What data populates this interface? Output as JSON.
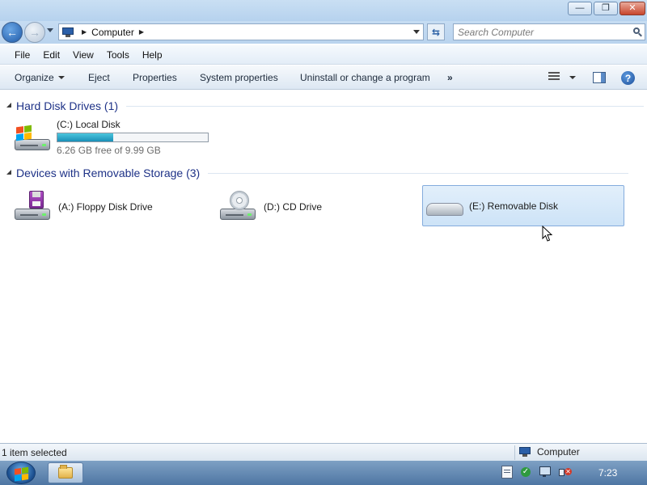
{
  "window": {
    "minimize_glyph": "—",
    "restore_glyph": "❐",
    "close_glyph": "✕"
  },
  "address": {
    "location": "Computer",
    "search_placeholder": "Search Computer"
  },
  "menu": {
    "file": "File",
    "edit": "Edit",
    "view": "View",
    "tools": "Tools",
    "help": "Help"
  },
  "commands": {
    "organize": "Organize",
    "eject": "Eject",
    "properties": "Properties",
    "system_properties": "System properties",
    "uninstall": "Uninstall or change a program",
    "more": "»"
  },
  "groups": {
    "hard_disk": {
      "title": "Hard Disk Drives (1)",
      "drives": [
        {
          "label": "(C:) Local Disk",
          "capacity_text": "6.26 GB free of 9.99 GB",
          "used_fraction": 0.373,
          "icon": "hard-drive-windows-icon"
        }
      ]
    },
    "removable": {
      "title": "Devices with Removable Storage (3)",
      "drives": [
        {
          "label": "(A:) Floppy Disk Drive",
          "icon": "floppy-drive-icon"
        },
        {
          "label": "(D:) CD Drive",
          "icon": "cd-drive-icon"
        },
        {
          "label": "(E:) Removable Disk",
          "icon": "removable-disk-icon",
          "selected": true
        }
      ]
    }
  },
  "status": {
    "selection": "1 item selected",
    "location": "Computer"
  },
  "taskbar": {
    "clock": "7:23"
  },
  "colors": {
    "group_title": "#1e3287",
    "capacity_fill": "#1a8fb7",
    "selection_border": "#84acdd"
  }
}
